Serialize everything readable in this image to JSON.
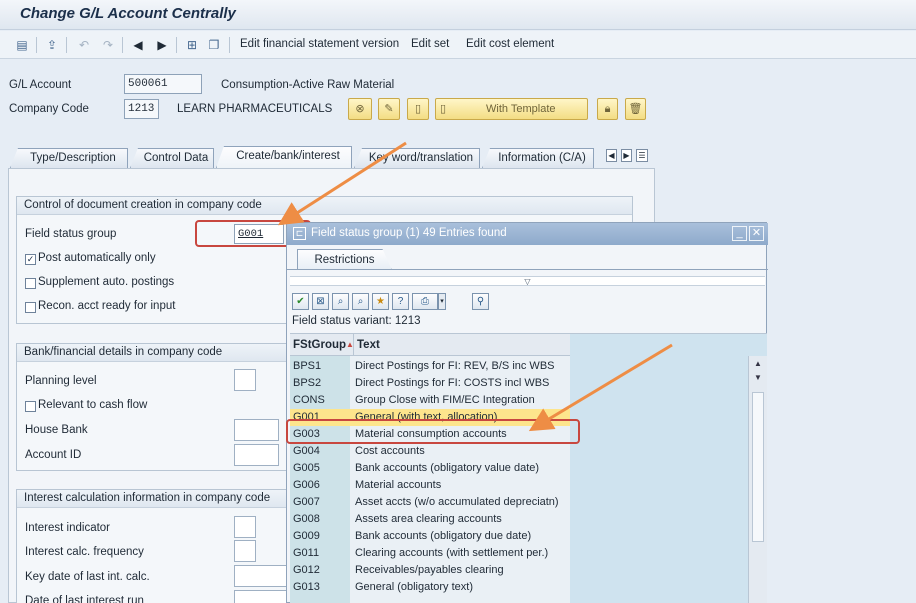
{
  "window": {
    "title": "Change G/L Account Centrally"
  },
  "toolbar": {
    "icons": [
      "switch-icon",
      "other-icon",
      "undo-icon",
      "redo-icon",
      "previous-icon",
      "next-icon",
      "hierarchy-icon",
      "copy-icon"
    ],
    "edit_fs_version": "Edit financial statement version",
    "edit_set": "Edit set",
    "edit_cost_element": "Edit cost element"
  },
  "header": {
    "gl_account_label": "G/L Account",
    "gl_account_value": "500061",
    "gl_account_desc": "Consumption-Active Raw Material",
    "company_code_label": "Company Code",
    "company_code_value": "1213",
    "company_name": "LEARN PHARMACEUTICALS",
    "with_template": "With Template"
  },
  "tabs": [
    {
      "label": "Type/Description"
    },
    {
      "label": "Control Data"
    },
    {
      "label": "Create/bank/interest"
    },
    {
      "label": "Key word/translation"
    },
    {
      "label": "Information (C/A)"
    }
  ],
  "doc_control": {
    "heading": "Control of document creation in company code",
    "field_status_group_label": "Field status group",
    "field_status_group_value": "G001",
    "post_auto_label": "Post automatically only",
    "post_auto_checked": "✓",
    "supplement_label": "Supplement auto. postings",
    "recon_label": "Recon. acct ready for input"
  },
  "bank_details": {
    "heading": "Bank/financial details in company code",
    "planning_level_label": "Planning level",
    "relevant_cash_flow_label": "Relevant to cash flow",
    "house_bank_label": "House Bank",
    "account_id_label": "Account ID"
  },
  "interest": {
    "heading": "Interest calculation information in company code",
    "indicator_label": "Interest indicator",
    "frequency_label": "Interest calc. frequency",
    "key_date_label": "Key date of last int. calc.",
    "last_run_label": "Date of last interest run"
  },
  "popup": {
    "title": "Field status group (1)   49 Entries found",
    "restrictions_tab": "Restrictions",
    "variant": "Field status variant: 1213",
    "col_group": "FStGroup",
    "col_text": "Text",
    "rows": [
      {
        "group": "BPS1",
        "text": "Direct Postings for FI: REV, B/S inc WBS"
      },
      {
        "group": "BPS2",
        "text": "Direct Postings for FI: COSTS incl WBS"
      },
      {
        "group": "CONS",
        "text": "Group Close with FIM/EC Integration"
      },
      {
        "group": "G001",
        "text": "General (with text, allocation)"
      },
      {
        "group": "G003",
        "text": "Material consumption accounts"
      },
      {
        "group": "G004",
        "text": "Cost accounts"
      },
      {
        "group": "G005",
        "text": "Bank accounts (obligatory value date)"
      },
      {
        "group": "G006",
        "text": "Material accounts"
      },
      {
        "group": "G007",
        "text": "Asset accts (w/o accumulated depreciatn)"
      },
      {
        "group": "G008",
        "text": "Assets area clearing accounts"
      },
      {
        "group": "G009",
        "text": "Bank accounts (obligatory due date)"
      },
      {
        "group": "G011",
        "text": "Clearing accounts (with settlement per.)"
      },
      {
        "group": "G012",
        "text": "Receivables/payables clearing"
      },
      {
        "group": "G013",
        "text": "General (obligatory text)"
      }
    ],
    "selected_index": 3
  },
  "colors": {
    "arrow": "#ee8d45",
    "highlight_border": "#c8473f",
    "selected_row": "#fde58c"
  }
}
